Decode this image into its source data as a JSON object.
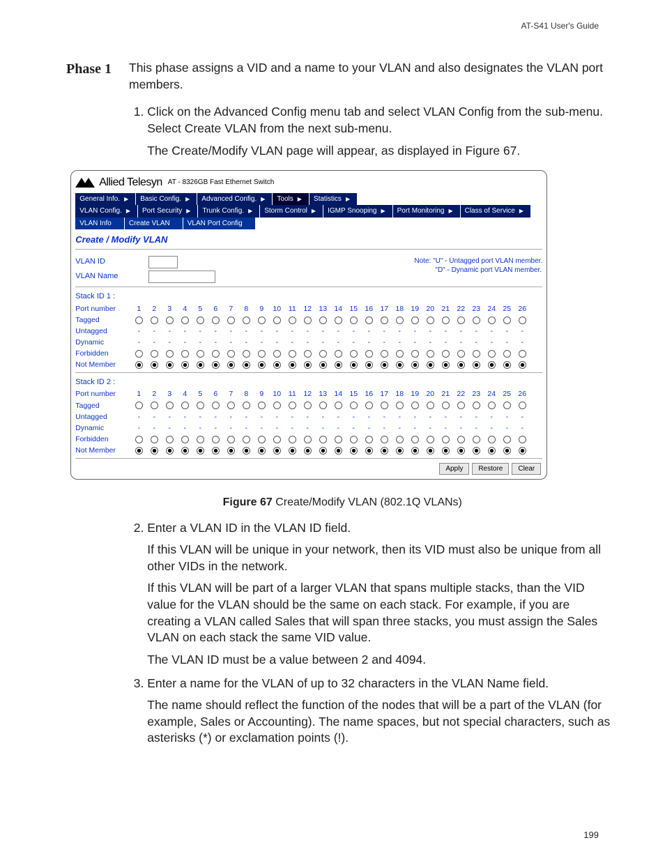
{
  "header": {
    "guide": "AT-S41 User's Guide"
  },
  "phase": {
    "label": "Phase 1",
    "intro": "This phase assigns a VID and a name to your VLAN and also designates the VLAN port members.",
    "step1a": "Click on the Advanced Config menu tab and select VLAN Config from the sub-menu. Select Create VLAN from the next sub-menu.",
    "step1b": "The Create/Modify VLAN page will appear, as displayed in Figure 67."
  },
  "screenshot": {
    "brand": "Allied Telesyn",
    "brand_sub": "AT - 8326GB Fast Ethernet Switch",
    "menu1": [
      "General Info.",
      "Basic Config.",
      "Advanced Config.",
      "Tools",
      "Statistics"
    ],
    "menu2": [
      "VLAN Config.",
      "Port Security",
      "Trunk Config.",
      "Storm Control",
      "IGMP Snooping",
      "Port Monitoring",
      "Class of Service"
    ],
    "menu3": [
      "VLAN Info",
      "Create VLAN",
      "VLAN Port Config"
    ],
    "title": "Create / Modify VLAN",
    "fields": {
      "vlan_id": "VLAN ID",
      "vlan_name": "VLAN Name"
    },
    "note1": "Note: \"U\" - Untagged port VLAN member.",
    "note2": "\"D\" - Dynamic port VLAN member.",
    "stacks": [
      {
        "title": "Stack ID 1 :"
      },
      {
        "title": "Stack ID 2 :"
      }
    ],
    "port_count": 26,
    "rows": [
      {
        "label": "Port number",
        "type": "header"
      },
      {
        "label": "Tagged",
        "type": "radio"
      },
      {
        "label": "Untagged",
        "type": "dash"
      },
      {
        "label": "Dynamic",
        "type": "dash"
      },
      {
        "label": "Forbidden",
        "type": "radio"
      },
      {
        "label": "Not Member",
        "type": "radio_sel"
      }
    ],
    "buttons": {
      "apply": "Apply",
      "restore": "Restore",
      "clear": "Clear"
    }
  },
  "figcaption": {
    "num": "Figure 67",
    "text": "  Create/Modify VLAN (802.1Q VLANs)"
  },
  "steps_after": {
    "s2a": "Enter a VLAN ID in the VLAN ID field.",
    "s2b": "If this VLAN will be unique in your network, then its VID must also be unique from all other VIDs in the network.",
    "s2c": "If this VLAN will be part of a larger VLAN that spans multiple stacks, than the VID value for the VLAN should be the same on each stack. For example, if you are creating a VLAN called Sales that will span three stacks, you must assign the Sales VLAN on each stack the same VID value.",
    "s2d": "The VLAN ID must be a value between 2 and 4094.",
    "s3a": "Enter a name for the VLAN of up to 32 characters in the VLAN Name field.",
    "s3b": "The name should reflect the function of the nodes that will be a part of the VLAN (for example, Sales or Accounting). The name spaces, but not special characters, such as asterisks (*) or exclamation points (!)."
  },
  "page_number": "199"
}
